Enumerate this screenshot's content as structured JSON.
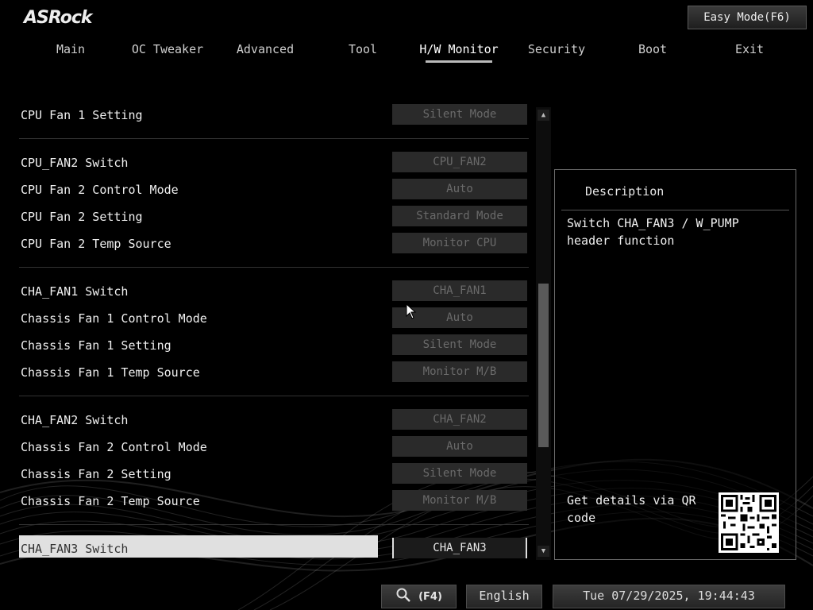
{
  "brand": "ASRock",
  "easy_mode": "Easy Mode(F6)",
  "nav": [
    "Main",
    "OC Tweaker",
    "Advanced",
    "Tool",
    "H/W Monitor",
    "Security",
    "Boot",
    "Exit"
  ],
  "active_tab": "H/W Monitor",
  "groups": [
    {
      "rows": [
        {
          "label": "CPU Fan 1 Setting",
          "value": "Silent Mode"
        }
      ]
    },
    {
      "rows": [
        {
          "label": "CPU_FAN2 Switch",
          "value": "CPU_FAN2"
        },
        {
          "label": "CPU Fan 2 Control Mode",
          "value": "Auto"
        },
        {
          "label": "CPU Fan 2 Setting",
          "value": "Standard Mode"
        },
        {
          "label": "CPU Fan 2 Temp Source",
          "value": "Monitor CPU"
        }
      ]
    },
    {
      "rows": [
        {
          "label": "CHA_FAN1 Switch",
          "value": "CHA_FAN1"
        },
        {
          "label": "Chassis Fan 1 Control Mode",
          "value": "Auto"
        },
        {
          "label": "Chassis Fan 1 Setting",
          "value": "Silent Mode"
        },
        {
          "label": "Chassis Fan 1 Temp Source",
          "value": "Monitor M/B"
        }
      ]
    },
    {
      "rows": [
        {
          "label": "CHA_FAN2 Switch",
          "value": "CHA_FAN2"
        },
        {
          "label": "Chassis Fan 2 Control Mode",
          "value": "Auto"
        },
        {
          "label": "Chassis Fan 2 Setting",
          "value": "Silent Mode"
        },
        {
          "label": "Chassis Fan 2 Temp Source",
          "value": "Monitor M/B"
        }
      ]
    },
    {
      "rows": [
        {
          "label": "CHA_FAN3 Switch",
          "value": "CHA_FAN3",
          "selected": true
        }
      ]
    }
  ],
  "description": {
    "title": "Description",
    "text": "Switch CHA_FAN3 / W_PUMP header function",
    "qr_text": "Get details via QR code"
  },
  "bottom": {
    "search_key": "(F4)",
    "language": "English",
    "datetime": "Tue 07/29/2025, 19:44:43"
  },
  "icons": {
    "search": "search-icon",
    "scroll_up": "scroll-up-icon",
    "scroll_down": "scroll-down-icon",
    "qr": "qr-code-icon",
    "cursor": "mouse-cursor-icon"
  },
  "colors": {
    "background": "#000000",
    "value_box": "#2a2a2a",
    "selected_row": "#e0e0e0"
  }
}
